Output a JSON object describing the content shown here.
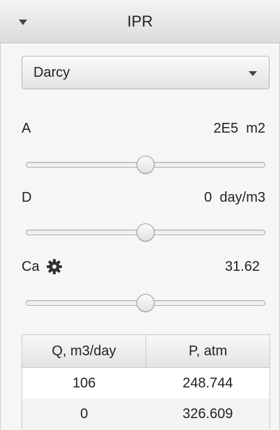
{
  "pane": {
    "title": "IPR"
  },
  "model_select": {
    "value": "Darcy"
  },
  "params": [
    {
      "label": "A",
      "value": "2E5  m2",
      "slider_fraction": 0.5
    },
    {
      "label": "D",
      "value": "0  day/m3",
      "slider_fraction": 0.5
    },
    {
      "label": "Ca",
      "value": "31.62",
      "slider_fraction": 0.5,
      "icon": "gear-icon"
    }
  ],
  "table": {
    "headers": [
      "Q, m3/day",
      "P, atm"
    ],
    "rows": [
      [
        "106",
        "248.744"
      ],
      [
        "0",
        "326.609"
      ]
    ]
  }
}
